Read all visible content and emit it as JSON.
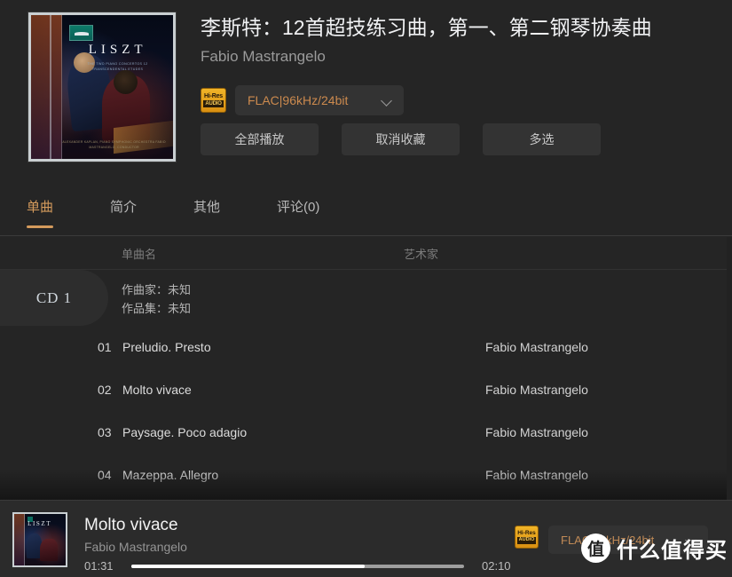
{
  "album": {
    "title": "李斯特：12首超技练习曲，第一、第二钢琴协奏曲",
    "artist": "Fabio Mastrangelo",
    "cover": {
      "logo_name": "label-logo-icon",
      "title_text": "LISZT",
      "subtitle_text": "THE TWO PIANO CONCERTOS 12 TRANSCENDENTAL ETUDES",
      "credits_text": "ALEXANDER KAPLAN, PIANO SYMPHONIC ORCHESTRA FABIO MASTRANGELO, CONDUCTOR"
    }
  },
  "format": {
    "badge_hires": "Hi-Res",
    "badge_audio": "AUDIO",
    "value": "FLAC|96kHz/24bit",
    "chevron": "chevron-down-icon"
  },
  "actions": {
    "play_all": "全部播放",
    "unfavorite": "取消收藏",
    "multiselect": "多选"
  },
  "tabs": [
    {
      "label": "单曲",
      "active": true
    },
    {
      "label": "简介",
      "active": false
    },
    {
      "label": "其他",
      "active": false
    },
    {
      "label": "评论(0)",
      "active": false
    }
  ],
  "tracklist": {
    "columns": {
      "name": "单曲名",
      "artist": "艺术家"
    },
    "disc": {
      "label": "CD 1",
      "composer": "作曲家：未知",
      "collection": "作品集：未知"
    },
    "tracks": [
      {
        "num": "01",
        "name": "Preludio. Presto",
        "artist": "Fabio Mastrangelo"
      },
      {
        "num": "02",
        "name": "Molto vivace",
        "artist": "Fabio Mastrangelo"
      },
      {
        "num": "03",
        "name": "Paysage. Poco adagio",
        "artist": "Fabio Mastrangelo"
      },
      {
        "num": "04",
        "name": "Mazeppa. Allegro",
        "artist": "Fabio Mastrangelo"
      }
    ]
  },
  "player": {
    "now_playing_title": "Molto vivace",
    "now_playing_artist": "Fabio Mastrangelo",
    "time_current": "01:31",
    "time_total": "02:10",
    "progress_percent": 70,
    "badge_hires": "Hi-Res",
    "badge_audio": "AUDIO",
    "format_value": "FLAC|96kHz/24bit",
    "chevron": "chevron-down-icon"
  },
  "watermark": {
    "logo_char": "值",
    "text": "什么值得买"
  },
  "colors": {
    "background": "#252525",
    "panel": "#333333",
    "accent": "#d49a5c",
    "format_text": "#cc8a4e",
    "badge_gold": "#e0a41c",
    "text_primary": "#f0f1f3",
    "text_secondary": "#9a9a9a"
  }
}
